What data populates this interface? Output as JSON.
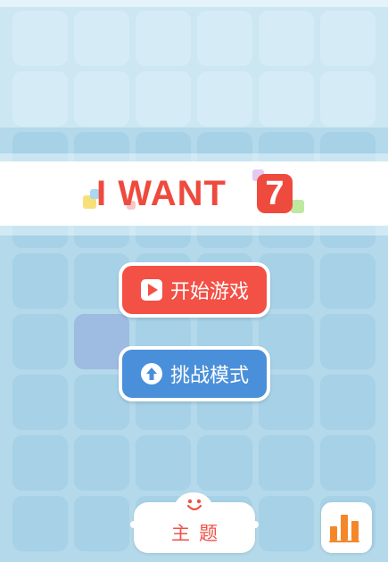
{
  "logo": {
    "text": "I WANT",
    "number": "7"
  },
  "buttons": {
    "start_label": "开始游戏",
    "challenge_label": "挑战模式"
  },
  "theme": {
    "label": "主题"
  },
  "icons": {
    "start": "play-icon",
    "challenge": "arrow-up-icon",
    "theme": "smile-icon",
    "rank": "bar-chart-icon"
  },
  "colors": {
    "red": "#f35046",
    "blue": "#4a8fd9",
    "orange": "#f5872b",
    "board": "#b3d9ea"
  }
}
